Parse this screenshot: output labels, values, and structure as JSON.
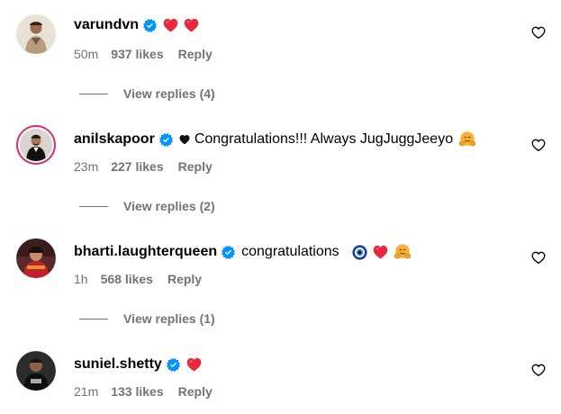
{
  "comments": [
    {
      "username": "varundvn",
      "text_before": "",
      "text": "",
      "time": "50m",
      "likes": "937 likes",
      "reply_label": "Reply",
      "view_replies": "View replies (4)"
    },
    {
      "username": "anilskapoor",
      "text_before": "",
      "text": "Congratulations!!! Always JugJuggJeeyo",
      "time": "23m",
      "likes": "227 likes",
      "reply_label": "Reply",
      "view_replies": "View replies (2)"
    },
    {
      "username": "bharti.laughterqueen",
      "text": "congratulations",
      "time": "1h",
      "likes": "568 likes",
      "reply_label": "Reply",
      "view_replies": "View replies (1)"
    },
    {
      "username": "suniel.shetty",
      "text": "",
      "time": "21m",
      "likes": "133 likes",
      "reply_label": "Reply"
    }
  ],
  "icons": {
    "verified": "verified-badge-icon",
    "like": "heart-outline-icon",
    "red_heart": "red-heart-emoji-icon",
    "black_heart": "black-heart-emoji-icon",
    "nazar": "nazar-amulet-emoji-icon",
    "hug": "hugging-face-emoji-icon"
  },
  "colors": {
    "verified_blue": "#0095f6",
    "meta_gray": "#737373",
    "heart_red": "#e8283c",
    "story_ring": "#d62976"
  }
}
